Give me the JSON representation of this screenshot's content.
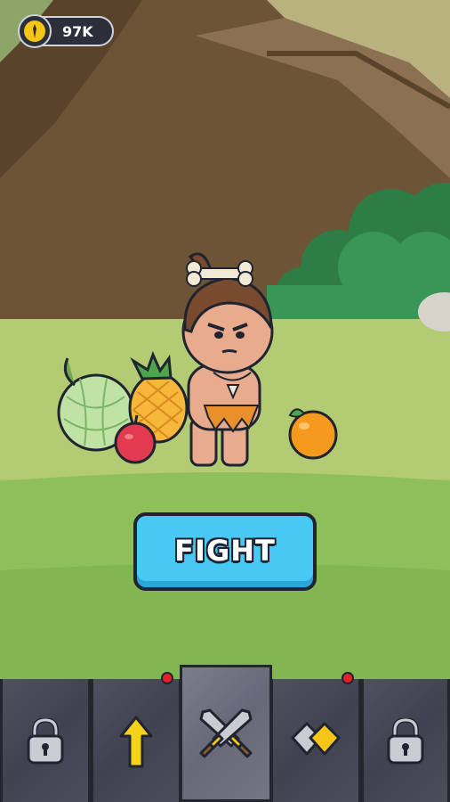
{
  "hud": {
    "coins": "97K",
    "coin_icon": "coin-icon",
    "accent": "#f5c518"
  },
  "main": {
    "fight_label": "FIGHT",
    "fight_color": "#48c9f4"
  },
  "nav": {
    "tabs": [
      {
        "icon": "lock-icon",
        "locked": true,
        "notification": false
      },
      {
        "icon": "upgrade-arrow-icon",
        "locked": false,
        "notification": true
      },
      {
        "icon": "crossed-swords-icon",
        "locked": false,
        "active": true,
        "notification": false
      },
      {
        "icon": "gems-icon",
        "locked": false,
        "notification": true
      },
      {
        "icon": "lock-icon",
        "locked": true,
        "notification": false
      }
    ]
  }
}
